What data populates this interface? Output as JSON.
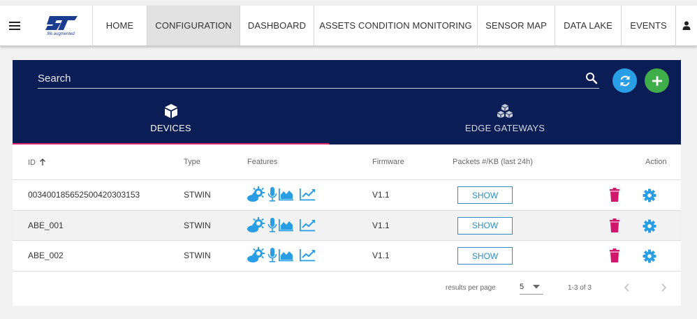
{
  "topbar": {
    "logo_tagline": "life.augmented",
    "nav": [
      {
        "label": "HOME",
        "width": 78,
        "active": false
      },
      {
        "label": "CONFIGURATION",
        "active": true
      },
      {
        "label": "DASHBOARD",
        "active": false
      },
      {
        "label": "ASSETS CONDITION MONITORING",
        "active": false
      },
      {
        "label": "SENSOR MAP",
        "active": false
      },
      {
        "label": "DATA LAKE",
        "active": false
      },
      {
        "label": "EVENTS",
        "active": false
      }
    ]
  },
  "search": {
    "placeholder": "Search"
  },
  "tabs": {
    "devices": "DEVICES",
    "gateways": "EDGE GATEWAYS"
  },
  "table": {
    "headers": {
      "id": "ID",
      "type": "Type",
      "features": "Features",
      "firmware": "Firmware",
      "packets": "Packets #/KB (last 24h)",
      "action": "Action"
    },
    "rows": [
      {
        "id": "003400185652500420303153",
        "type": "STWIN",
        "firmware": "V1.1",
        "show": "SHOW"
      },
      {
        "id": "ABE_001",
        "type": "STWIN",
        "firmware": "V1.1",
        "show": "SHOW"
      },
      {
        "id": "ABE_002",
        "type": "STWIN",
        "firmware": "V1.1",
        "show": "SHOW"
      }
    ]
  },
  "pagination": {
    "results_per_page_label": "results per page",
    "results_per_page": "5",
    "range": "1-3 of 3"
  },
  "colors": {
    "header_bg": "#0b1d55",
    "tab_indicator": "#e0266f",
    "feature_icon": "#2a9ee5",
    "delete_icon": "#d0176b",
    "settings_icon": "#2a9ee5",
    "refresh_fab": "#2a9ee5",
    "add_fab": "#3fae4a"
  },
  "icons": {
    "refresh": "refresh-icon",
    "add": "plus-icon",
    "search": "search-icon",
    "devices": "cube-icon",
    "gateways": "cubes-icon",
    "delete": "trash-icon",
    "settings": "gear-icon"
  }
}
